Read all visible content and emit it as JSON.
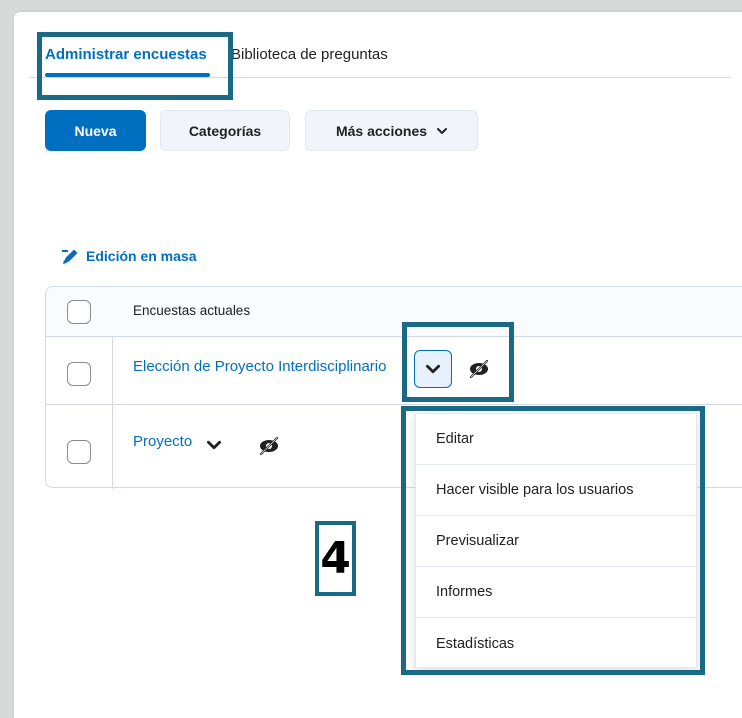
{
  "tabs": {
    "active_label": "Administrar encuestas",
    "inactive_label": "Biblioteca de preguntas"
  },
  "toolbar": {
    "new_label": "Nueva",
    "categories_label": "Categorías",
    "more_actions_label": "Más acciones"
  },
  "bulk_edit": {
    "label": "Edición en masa",
    "icon": "pencil-icon"
  },
  "table": {
    "header": "Encuestas actuales",
    "rows": [
      {
        "name": "Elección de Proyecto Interdisciplinario"
      },
      {
        "name": "Proyecto"
      }
    ]
  },
  "dropdown": {
    "items": [
      "Editar",
      "Hacer visible para los usuarios",
      "Previsualizar",
      "Informes",
      "Estadísticas"
    ]
  },
  "step_label": "4",
  "colors": {
    "accent": "#006fbf",
    "highlight": "#1a6a85",
    "background": "#d8d9d9"
  }
}
